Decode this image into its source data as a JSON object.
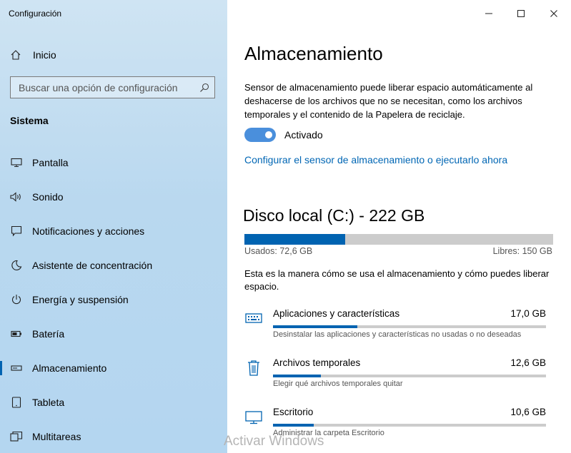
{
  "window": {
    "title": "Configuración"
  },
  "sidebar": {
    "home_label": "Inicio",
    "search_placeholder": "Buscar una opción de configuración",
    "group_title": "Sistema",
    "items": [
      {
        "label": "Pantalla",
        "icon": "monitor-icon"
      },
      {
        "label": "Sonido",
        "icon": "speaker-icon"
      },
      {
        "label": "Notificaciones y acciones",
        "icon": "notification-icon"
      },
      {
        "label": "Asistente de concentración",
        "icon": "moon-icon"
      },
      {
        "label": "Energía y suspensión",
        "icon": "power-icon"
      },
      {
        "label": "Batería",
        "icon": "battery-icon"
      },
      {
        "label": "Almacenamiento",
        "icon": "storage-icon",
        "selected": true
      },
      {
        "label": "Tableta",
        "icon": "tablet-icon"
      },
      {
        "label": "Multitareas",
        "icon": "multitask-icon"
      }
    ]
  },
  "main": {
    "title": "Almacenamiento",
    "sense_description": "Sensor de almacenamiento puede liberar espacio automáticamente al deshacerse de los archivos que no se necesitan, como los archivos temporales y el contenido de la Papelera de reciclaje.",
    "toggle_label": "Activado",
    "toggle_on": true,
    "configure_link": "Configurar el sensor de almacenamiento o ejecutarlo ahora",
    "disk": {
      "title": "Disco local (C:) - 222 GB",
      "used_label": "Usados: 72,6 GB",
      "free_label": "Libres: 150 GB",
      "used_fraction": 0.327
    },
    "usage_intro": "Esta es la manera cómo se usa el almacenamiento y cómo puedes liberar espacio.",
    "categories": [
      {
        "name": "Aplicaciones y características",
        "size": "17,0 GB",
        "description": "Desinstalar las aplicaciones y características no usadas o no deseadas",
        "fraction": 0.31,
        "icon": "keyboard-icon"
      },
      {
        "name": "Archivos temporales",
        "size": "12,6 GB",
        "description": "Elegir qué archivos temporales quitar",
        "fraction": 0.175,
        "icon": "trash-icon"
      },
      {
        "name": "Escritorio",
        "size": "10,6 GB",
        "description": "Administrar la carpeta Escritorio",
        "fraction": 0.148,
        "icon": "desktop-icon"
      }
    ]
  },
  "watermark": "Activar Windows",
  "colors": {
    "accent": "#0063b1",
    "link": "#0066b4",
    "toggle": "#4a8fdc"
  }
}
